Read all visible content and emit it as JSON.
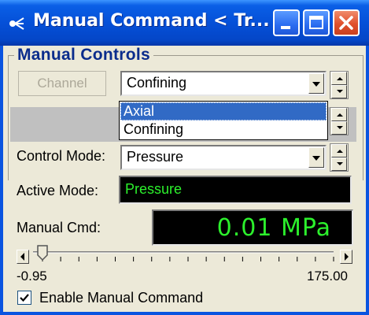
{
  "window": {
    "title": "Manual Command < Tr...",
    "controls": [
      "minimize",
      "maximize",
      "close"
    ]
  },
  "group": {
    "label": "Manual Controls"
  },
  "channel": {
    "button_label": "Channel",
    "selected": "Confining",
    "options": [
      "Axial",
      "Confining"
    ],
    "highlighted": "Axial"
  },
  "control_mode": {
    "label": "Control Mode:",
    "selected": "Pressure"
  },
  "active_mode": {
    "label": "Active Mode:",
    "value": "Pressure"
  },
  "manual_cmd": {
    "label": "Manual Cmd:",
    "value": "0.01  MPa"
  },
  "slider": {
    "min_label": "-0.95",
    "max_label": "175.00",
    "level_fraction": 0.0
  },
  "enable": {
    "label": "Enable Manual Command",
    "checked": true
  },
  "colors": {
    "title_bar": "#0a54e0",
    "group_label": "#0a2c8c",
    "readout_text": "#2cf02c",
    "highlight": "#316ac5"
  },
  "icons": [
    "app-icon",
    "minimize-icon",
    "maximize-icon",
    "close-icon",
    "chevron-down-icon",
    "spin-up-icon",
    "spin-down-icon",
    "scroll-left-icon",
    "scroll-right-icon",
    "checkmark-icon"
  ]
}
